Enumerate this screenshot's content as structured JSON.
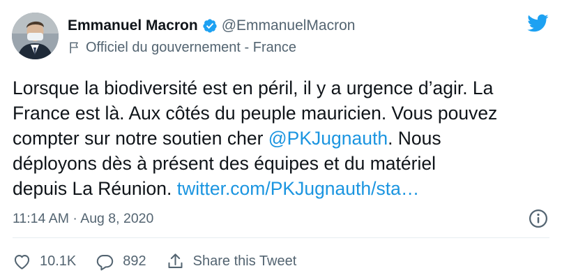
{
  "author": {
    "name": "Emmanuel Macron",
    "handle": "@EmmanuelMacron",
    "label": "Officiel du gouvernement - France"
  },
  "tweet": {
    "lines": [
      {
        "parts": [
          {
            "text": "Lorsque la biodiversité est en péril, il y a urgence d’agir. La"
          }
        ]
      },
      {
        "parts": [
          {
            "text": "France est là. Aux côtés du peuple mauricien. Vous pouvez"
          }
        ]
      },
      {
        "parts": [
          {
            "text": "compter sur notre soutien cher "
          },
          {
            "text": "@PKJugnauth",
            "link": true
          },
          {
            "text": ". Nous"
          }
        ]
      },
      {
        "parts": [
          {
            "text": "déployons dès à présent des équipes et du matériel"
          }
        ]
      },
      {
        "parts": [
          {
            "text": "depuis La Réunion. "
          },
          {
            "text": "twitter.com/PKJugnauth/sta…",
            "link": true
          }
        ]
      }
    ],
    "timestamp": "11:14 AM · Aug 8, 2020"
  },
  "actions": {
    "likes": "10.1K",
    "replies": "892",
    "share_label": "Share this Tweet"
  },
  "colors": {
    "link": "#1b95e0",
    "twitter_blue": "#1da1f2",
    "muted": "#536471"
  },
  "icons": {
    "verified": "verified-badge-icon",
    "bird": "twitter-bird-icon",
    "flag": "government-flag-icon",
    "info": "info-icon",
    "like": "heart-icon",
    "reply": "reply-bubble-icon",
    "share": "share-icon"
  }
}
